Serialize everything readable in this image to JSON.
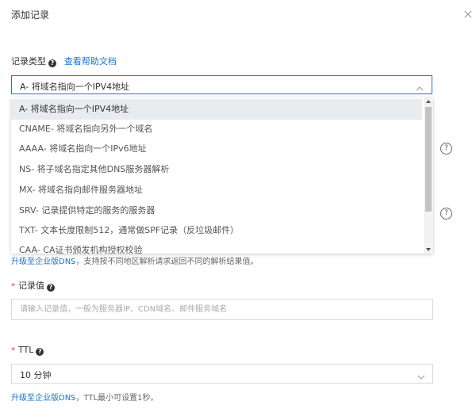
{
  "dialog": {
    "title": "添加记录"
  },
  "record_type": {
    "label": "记录类型",
    "help_link": "查看帮助文档",
    "selected": "A- 将域名指向一个IPV4地址",
    "options": [
      "A- 将域名指向一个IPV4地址",
      "CNAME- 将域名指向另外一个域名",
      "AAAA- 将域名指向一个IPv6地址",
      "NS- 将子域名指定其他DNS服务器解析",
      "MX- 将域名指向邮件服务器地址",
      "SRV- 记录提供特定的服务的服务器",
      "TXT- 文本长度限制512，通常做SPF记录（反垃圾邮件）",
      "CAA- CA证书颁发机构授权校验"
    ]
  },
  "line_hint": {
    "link": "升级至企业版DNS",
    "text": "，支持按不同地区解析请求返回不同的解析结果值。"
  },
  "record_value": {
    "label": "记录值",
    "placeholder": "请输入记录值，一般为服务器IP、CDN域名、邮件服务域名"
  },
  "ttl": {
    "label": "TTL",
    "selected": "10 分钟",
    "hint_link": "升级至企业版DNS",
    "hint_text": "，TTL最小可设置1秒。"
  },
  "help_icons": [
    "?",
    "?"
  ]
}
